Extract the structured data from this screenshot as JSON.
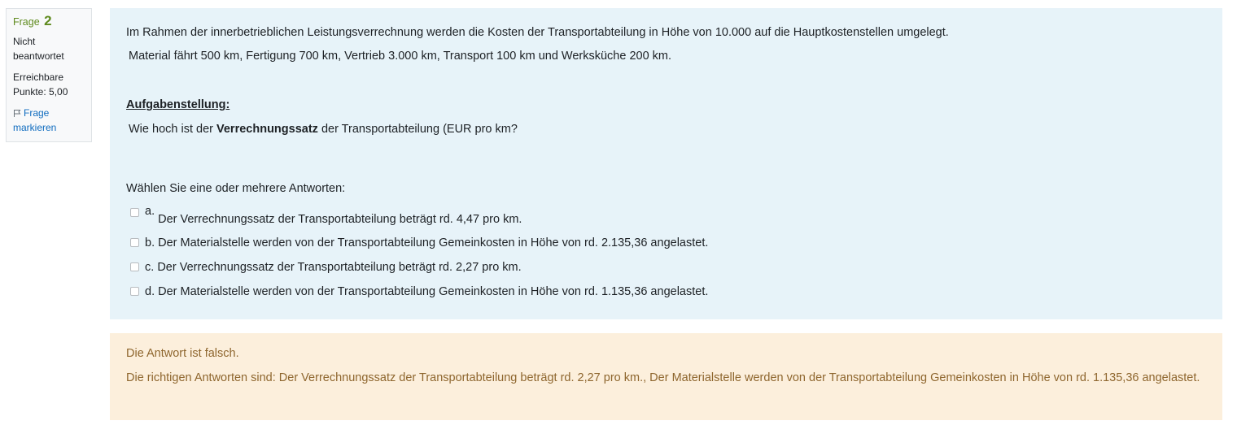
{
  "info": {
    "question_label": "Frage",
    "question_number": "2",
    "state_line1": "Nicht",
    "state_line2": "beantwortet",
    "grade_line1": "Erreichbare",
    "grade_line2": "Punkte: 5,00",
    "flag_line1": "Frage",
    "flag_line2": "markieren",
    "flag_icon": "flag-icon"
  },
  "question": {
    "line1": "Im Rahmen der innerbetrieblichen Leistungsverrechnung werden die Kosten der Transportabteilung in Höhe von 10.000 auf die Hauptkostenstellen umgelegt.",
    "line2": "Material fährt 500 km, Fertigung 700 km, Vertrieb 3.000 km, Transport 100 km und Werksküche 200 km.",
    "heading": "Aufgabenstellung:",
    "task_prefix": "Wie hoch ist der ",
    "task_bold": "Verrechnungssatz",
    "task_suffix": " der Transportabteilung (EUR pro km?",
    "prompt": "Wählen Sie eine oder mehrere Antworten:"
  },
  "answers": [
    {
      "letter": "a.",
      "text": "Der Verrechnungssatz der Transportabteilung beträgt rd. 4,47 pro km."
    },
    {
      "letter": "b.",
      "text": "Der Materialstelle werden von der Transportabteilung Gemeinkosten in Höhe von rd. 2.135,36 angelastet."
    },
    {
      "letter": "c.",
      "text": "Der Verrechnungssatz der Transportabteilung beträgt rd. 2,27 pro km."
    },
    {
      "letter": "d.",
      "text": "Der Materialstelle werden von der Transportabteilung Gemeinkosten in Höhe von rd. 1.135,36 angelastet."
    }
  ],
  "feedback": {
    "status": "Die Antwort ist falsch.",
    "correct": "Die richtigen Antworten sind: Der Verrechnungssatz der Transportabteilung beträgt rd. 2,27 pro km., Der Materialstelle werden von der Transportabteilung Gemeinkosten in Höhe von rd. 1.135,36 angelastet."
  },
  "colors": {
    "formulation_bg": "#e7f3f9",
    "feedback_bg": "#fcefdc",
    "feedback_text": "#8e662e",
    "question_number": "#5f8b1e",
    "link": "#0f6cbf"
  }
}
